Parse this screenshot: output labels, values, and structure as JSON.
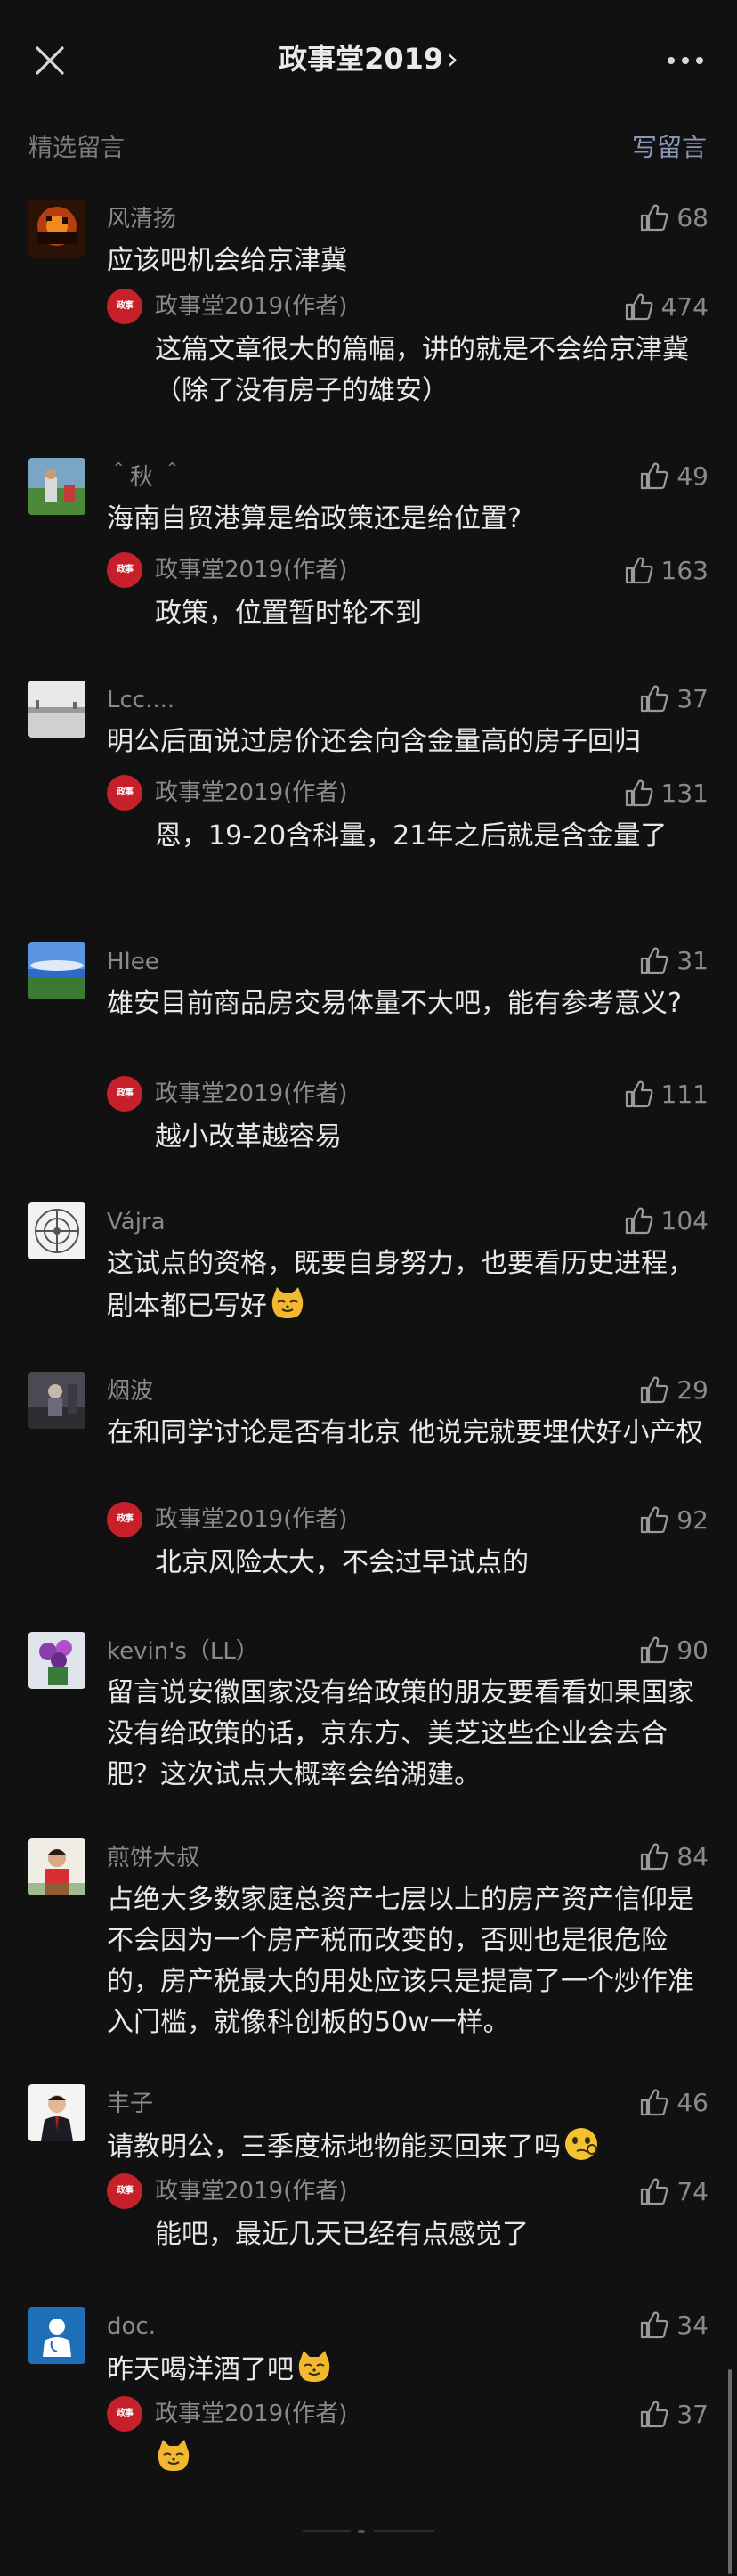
{
  "header": {
    "title": "政事堂2019",
    "chevron": "›",
    "close_icon": "close-icon",
    "more_icon": "more-icon"
  },
  "section": {
    "label": "精选留言",
    "write_label": "写留言"
  },
  "colors": {
    "background": "#111111",
    "accent_link": "#8b97b6",
    "author_badge": "#c8202a"
  },
  "comments": [
    {
      "nick": "风清扬",
      "likes": "68",
      "text": "应该吧机会给京津冀",
      "reply": {
        "author": "政事堂2019(作者)",
        "likes": "474",
        "text": "这篇文章很大的篇幅，讲的就是不会给京津冀（除了没有房子的雄安）"
      }
    },
    {
      "nick": "＾秋 ＾",
      "likes": "49",
      "text": "海南自贸港算是给政策还是给位置?",
      "reply": {
        "author": "政事堂2019(作者)",
        "likes": "163",
        "text": "政策，位置暂时轮不到"
      }
    },
    {
      "nick": "Lcc....",
      "likes": "37",
      "text": "明公后面说过房价还会向含金量高的房子回归",
      "reply": {
        "author": "政事堂2019(作者)",
        "likes": "131",
        "text": "恩，19-20含科量，21年之后就是含金量了"
      }
    },
    {
      "nick": "Hlee",
      "likes": "31",
      "text": "雄安目前商品房交易体量不大吧，能有参考意义?",
      "reply": {
        "author": "政事堂2019(作者)",
        "likes": "111",
        "text": "越小改革越容易"
      }
    },
    {
      "nick": "Vájra",
      "likes": "104",
      "text": "这试点的资格，既要自身努力，也要看历史进程，剧本都已写好",
      "emoji": "cat-emoji"
    },
    {
      "nick": "烟波",
      "likes": "29",
      "text": "在和同学讨论是否有北京  他说完就要埋伏好小产权",
      "reply": {
        "author": "政事堂2019(作者)",
        "likes": "92",
        "text": "北京风险太大，不会过早试点的"
      }
    },
    {
      "nick": "kevin's（LL）",
      "likes": "90",
      "text": "留言说安徽国家没有给政策的朋友要看看如果国家没有给政策的话，京东方、美芝这些企业会去合肥？这次试点大概率会给湖建。"
    },
    {
      "nick": "煎饼大叔",
      "likes": "84",
      "text": "占绝大多数家庭总资产七层以上的房产资产信仰是不会因为一个房产税而改变的，否则也是很危险的，房产税最大的用处应该只是提高了一个炒作准入门槛，就像科创板的50w一样。"
    },
    {
      "nick": "丰子",
      "likes": "46",
      "text": "请教明公，三季度标地物能买回来了吗",
      "emoji": "thinking-emoji",
      "reply": {
        "author": "政事堂2019(作者)",
        "likes": "74",
        "text": "能吧，最近几天已经有点感觉了"
      }
    },
    {
      "nick": "doc.",
      "likes": "34",
      "text": "昨天喝洋酒了吧",
      "emoji": "cat-emoji",
      "reply": {
        "author": "政事堂2019(作者)",
        "likes": "37",
        "text": "",
        "emoji": "cat-emoji"
      }
    }
  ]
}
